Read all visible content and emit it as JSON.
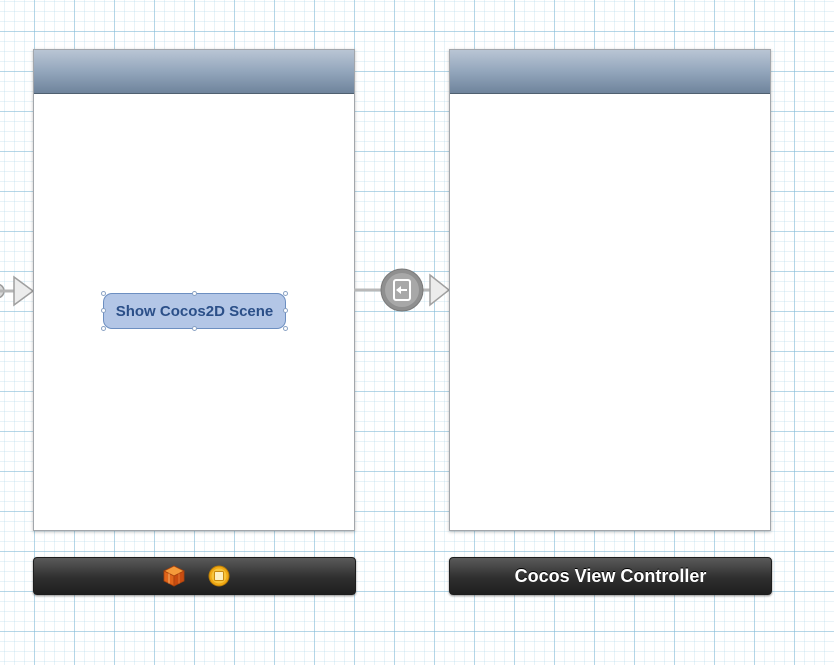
{
  "scenes": {
    "first": {
      "button_label": "Show Cocos2D Scene",
      "dock_icons": [
        "view-controller-cube-icon",
        "first-responder-icon"
      ]
    },
    "second": {
      "dock_title": "Cocos View Controller"
    }
  },
  "segue": {
    "icon": "push-segue-icon"
  },
  "colors": {
    "nav_bar_top": "#b9c5d4",
    "nav_bar_bottom": "#6f849c",
    "dock_background": "#2f2f2f",
    "button_fill": "#b3c6e6",
    "button_text": "#2b4f88",
    "grid_line": "#9fcde0"
  }
}
